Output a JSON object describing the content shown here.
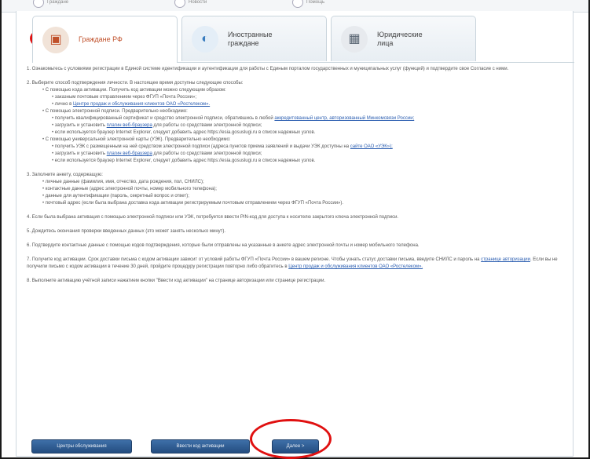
{
  "topnav": {
    "items": [
      {
        "label": "Граждане"
      },
      {
        "label": "Новости"
      },
      {
        "label": "Помощь"
      }
    ]
  },
  "tabs": [
    {
      "label": "Граждане РФ",
      "icon": "passport-icon",
      "active": true
    },
    {
      "label": "Иностранные граждане",
      "icon": "globe-icon",
      "active": false
    },
    {
      "label": "Юридические лица",
      "icon": "building-icon",
      "active": false
    }
  ],
  "steps": [
    {
      "text": "1. Ознакомьтесь с условиями регистрации в Единой системе идентификации и аутентификации для работы с Единым порталом государственных и муниципальных услуг (функций) и подтвердите свое Согласие с ними."
    },
    {
      "text": "2. Выберите способ подтверждения личности. В настоящее время доступны следующие способы:",
      "items": [
        {
          "text": "С помощью кода активации. Получить код активации можно следующим образом:",
          "sub": [
            {
              "text": "заказным почтовым отправлением через ФГУП «Почта России»;"
            },
            {
              "text": "лично в ",
              "link": "Центре продаж и обслуживания клиентов ОАО «Ростелеком»."
            }
          ]
        },
        {
          "text": "С помощью электронной подписи. Предварительно необходимо:",
          "sub": [
            {
              "text": "получить квалифицированный сертификат и средство электронной подписи, обратившись в любой ",
              "link": "аккредитованный центр, авторизованный Минкомсвязи России;"
            },
            {
              "text": "загрузить и установить ",
              "link": "плагин веб-браузера",
              "after": " для работы со средствами электронной подписи;"
            },
            {
              "text": "если используется браузер Internet Explorer, следует добавить адрес https://esia.gosuslugi.ru в список надежных узлов."
            }
          ]
        },
        {
          "text": "С помощью универсальной электронной карты (УЭК). Предварительно необходимо:",
          "sub": [
            {
              "text": "получить УЭК с размещенным на ней средством электронной подписи (адреса пунктов приема заявлений и выдачи УЭК доступны на ",
              "link": "сайте ОАО «УЭК»);"
            },
            {
              "text": "загрузить и установить ",
              "link": "плагин веб-браузера",
              "after": " для работы со средствами электронной подписи;"
            },
            {
              "text": "если используется браузер Internet Explorer, следует добавить адрес https://esia.gosuslugi.ru в список надежных узлов."
            }
          ]
        }
      ]
    },
    {
      "text": "3. Заполните анкету, содержащую:",
      "items": [
        {
          "text": "личные данные (фамилия, имя, отчество, дата рождения, пол, СНИЛС);"
        },
        {
          "text": "контактные данные (адрес электронной почты, номер мобильного телефона);"
        },
        {
          "text": "данные для аутентификации (пароль, секретный вопрос и ответ);"
        },
        {
          "text": "почтовый адрес (если была выбрана доставка кода активации регистрируемым почтовым отправлением через ФГУП «Почта России»)."
        }
      ]
    },
    {
      "text": "4. Если была выбрана активация с помощью электронной подписи или УЭК, потребуется ввести PIN-код для доступа к носителю закрытого ключа электронной подписи."
    },
    {
      "text": "5. Дождитесь окончания проверки введенных данных (это может занять несколько минут)."
    },
    {
      "text": "6. Подтвердите контактные данные с помощью кодов подтверждения, которые были отправлены на указанные в анкете адрес электронной почты и номер мобильного телефона."
    },
    {
      "text": "7. Получите код активации. Срок доставки письма с кодом активации зависит от условий работы ФГУП «Почта России» в вашем регионе. Чтобы узнать статус доставки письма, введите СНИЛС и пароль на ",
      "link": "странице авторизации",
      "after": ". Если вы не получили письмо с кодом активации в течение 30 дней, пройдите процедуру регистрации повторно либо обратитесь в ",
      "link2": "Центр продаж и обслуживания клиентов ОАО «Ростелеком»."
    },
    {
      "text": "8. Выполните активацию учётной записи нажатием кнопки \"Ввести код активации\" на странице авторизации или странице регистрации."
    }
  ],
  "buttons": {
    "centers": "Центры обслуживания",
    "enter_code": "Ввести код активации",
    "next": "Далее >"
  },
  "colors": {
    "accent": "#c0502a",
    "link": "#2a5db0",
    "button": "#2e5a90",
    "highlight": "#e01010"
  }
}
